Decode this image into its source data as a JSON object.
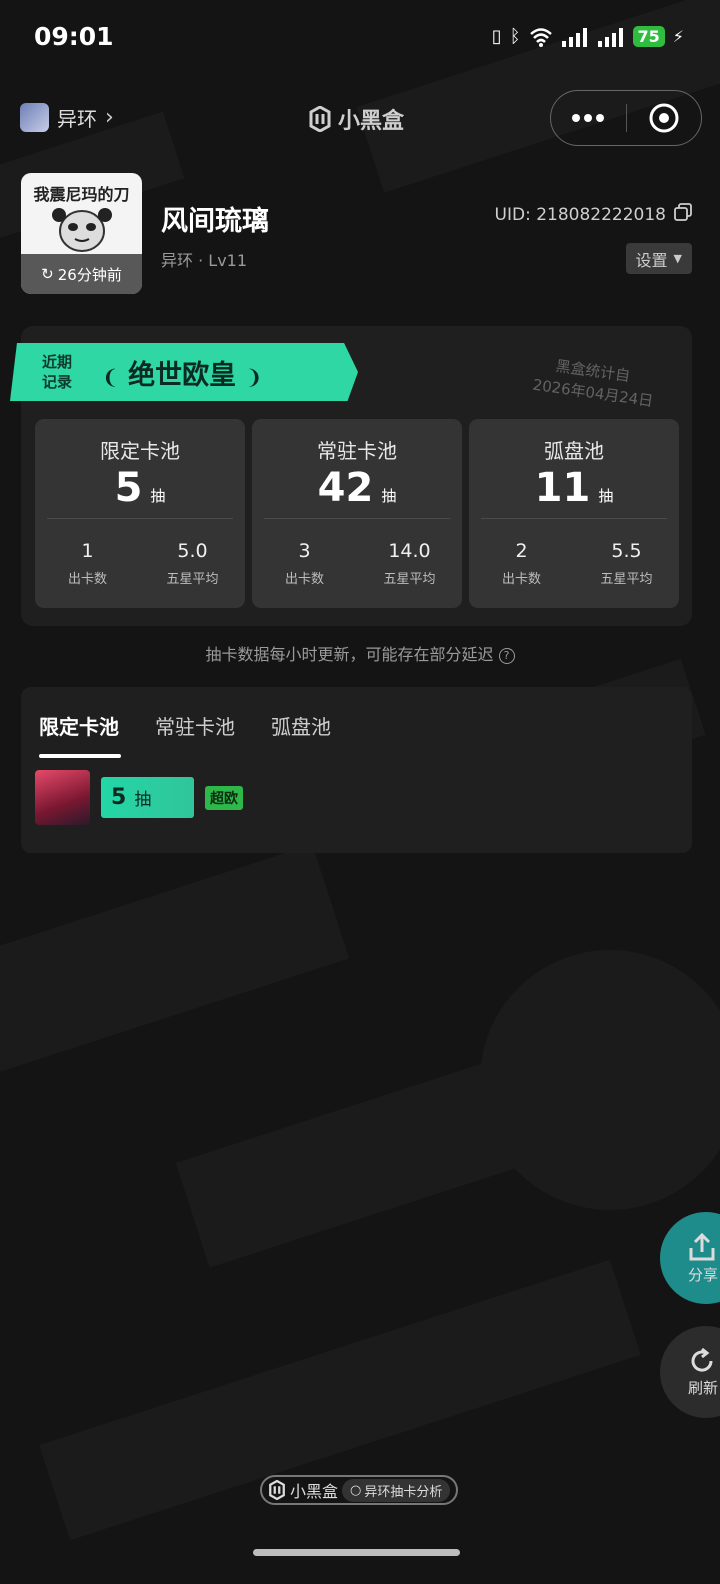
{
  "status_bar": {
    "time": "09:01",
    "battery": "75"
  },
  "header": {
    "game_name": "异环",
    "brand": "小黑盒"
  },
  "profile": {
    "avatar_caption": "我震尼玛的刀",
    "updated": "26分钟前",
    "nickname": "风间琉璃",
    "game": "异环",
    "level": "Lv11",
    "uid": "UID: 218082222018",
    "settings_label": "设置"
  },
  "summary": {
    "ribbon_label_1": "近期",
    "ribbon_label_2": "记录",
    "title": "绝世欧皇",
    "stamp_line_1": "黑盒统计自",
    "stamp_line_2": "2026年04月24日"
  },
  "pools": [
    {
      "name": "限定卡池",
      "count": "5",
      "unit": "抽",
      "cards": "1",
      "cards_label": "出卡数",
      "avg": "5.0",
      "avg_label": "五星平均"
    },
    {
      "name": "常驻卡池",
      "count": "42",
      "unit": "抽",
      "cards": "3",
      "cards_label": "出卡数",
      "avg": "14.0",
      "avg_label": "五星平均"
    },
    {
      "name": "弧盘池",
      "count": "11",
      "unit": "抽",
      "cards": "2",
      "cards_label": "出卡数",
      "avg": "5.5",
      "avg_label": "五星平均"
    }
  ],
  "note": "抽卡数据每小时更新，可能存在部分延迟",
  "tabs": [
    "限定卡池",
    "常驻卡池",
    "弧盘池"
  ],
  "records": [
    {
      "pulls": "5",
      "unit": "抽",
      "tag": "超欧"
    }
  ],
  "floating": {
    "share": "分享",
    "refresh": "刷新"
  },
  "footer": {
    "brand": "小黑盒",
    "search": "异环抽卡分析"
  },
  "colors": {
    "accent": "#2fd7a4",
    "share_bg": "#1e8c8a",
    "tag_green": "#2fb84a"
  }
}
